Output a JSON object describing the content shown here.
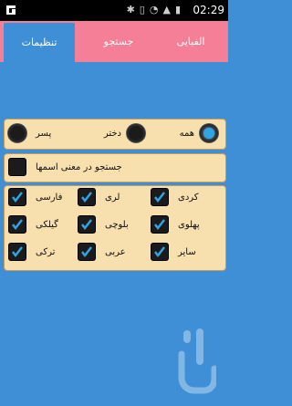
{
  "status": {
    "time": "02:29",
    "icons": [
      "bluetooth-icon",
      "vibrate-icon",
      "wifi-icon",
      "signal-icon",
      "battery-icon"
    ]
  },
  "tabs": [
    {
      "label": "تنظیمات",
      "active": true
    },
    {
      "label": "جستجو",
      "active": false
    },
    {
      "label": "الفبایی",
      "active": false
    }
  ],
  "gender": {
    "all": "همه",
    "girl": "دختر",
    "boy": "پسر",
    "selected": "all"
  },
  "search_meaning": {
    "label": "جستجو در معنی اسمها",
    "checked": false
  },
  "languages": {
    "kurdi": "کردی",
    "lori": "لری",
    "farsi": "فارسی",
    "pahlavi": "پهلوی",
    "balochi": "بلوچی",
    "gilaki": "گیلکی",
    "other": "سایر",
    "arabi": "عربی",
    "torki": "ترکی"
  },
  "colors": {
    "accent": "#3f8fd6",
    "tabbar": "#f47f97",
    "panel": "#f8dfae",
    "check": "#2fa4e7"
  }
}
